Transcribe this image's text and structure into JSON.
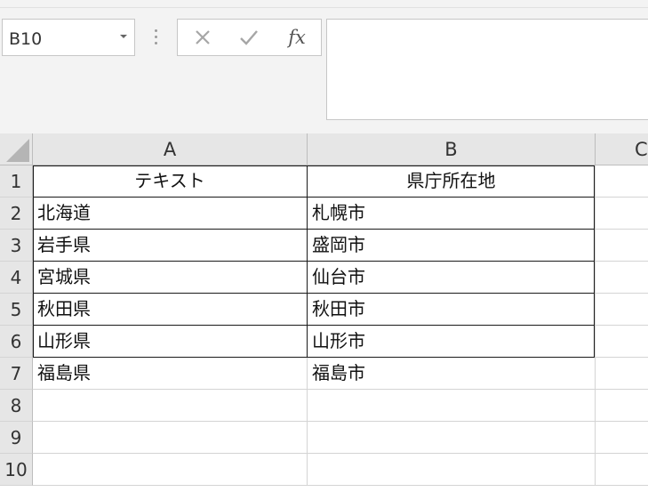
{
  "name_box": {
    "value": "B10"
  },
  "formula_buttons": {
    "cancel_icon": "close-icon",
    "enter_icon": "checkmark-icon",
    "fx_label": "fx"
  },
  "formula_bar": {
    "value": ""
  },
  "columns": [
    {
      "label": "A"
    },
    {
      "label": "B"
    },
    {
      "label": "C"
    }
  ],
  "rows": [
    {
      "label": "1",
      "cells": [
        "テキスト",
        "県庁所在地"
      ]
    },
    {
      "label": "2",
      "cells": [
        "北海道",
        "札幌市"
      ]
    },
    {
      "label": "3",
      "cells": [
        "岩手県",
        "盛岡市"
      ]
    },
    {
      "label": "4",
      "cells": [
        "宮城県",
        "仙台市"
      ]
    },
    {
      "label": "5",
      "cells": [
        "秋田県",
        "秋田市"
      ]
    },
    {
      "label": "6",
      "cells": [
        "山形県",
        "山形市"
      ]
    },
    {
      "label": "7",
      "cells": [
        "福島県",
        "福島市"
      ]
    },
    {
      "label": "8",
      "cells": [
        "",
        ""
      ]
    },
    {
      "label": "9",
      "cells": [
        "",
        ""
      ]
    },
    {
      "label": "10",
      "cells": [
        "",
        ""
      ]
    }
  ],
  "colors": {
    "header_bg": "#e6e6e6",
    "table_border": "#1a1a1a",
    "gridline": "#d4d4d4"
  }
}
